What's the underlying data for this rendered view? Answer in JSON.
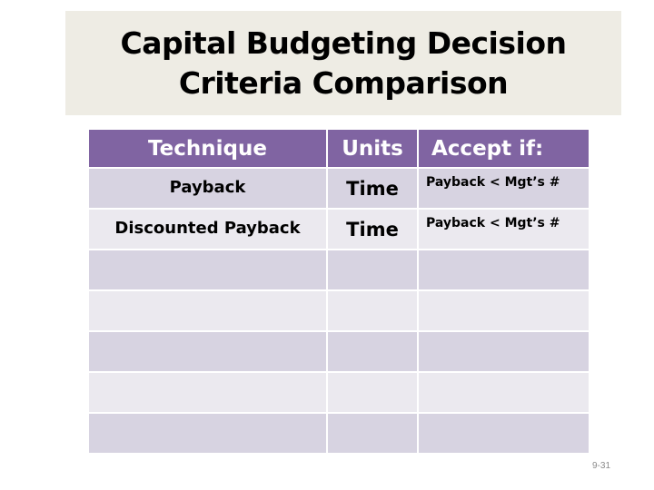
{
  "slide": {
    "title_lines": [
      "Capital Budgeting Decision",
      "Criteria Comparison"
    ],
    "page_number": "9-31"
  },
  "table": {
    "headers": [
      "Technique",
      "Units",
      "Accept if:"
    ],
    "rows": [
      [
        "Payback",
        "Time",
        "Payback < Mgt’s #"
      ],
      [
        "Discounted Payback",
        "Time",
        "Payback < Mgt’s #"
      ],
      [
        "",
        "",
        ""
      ],
      [
        "",
        "",
        ""
      ],
      [
        "",
        "",
        ""
      ],
      [
        "",
        "",
        ""
      ],
      [
        "",
        "",
        ""
      ]
    ]
  },
  "colors": {
    "header_bg": "#8064a2",
    "row_odd_bg": "#d7d3e1",
    "row_even_bg": "#ebe9ef",
    "title_bg": "#eeece4"
  }
}
